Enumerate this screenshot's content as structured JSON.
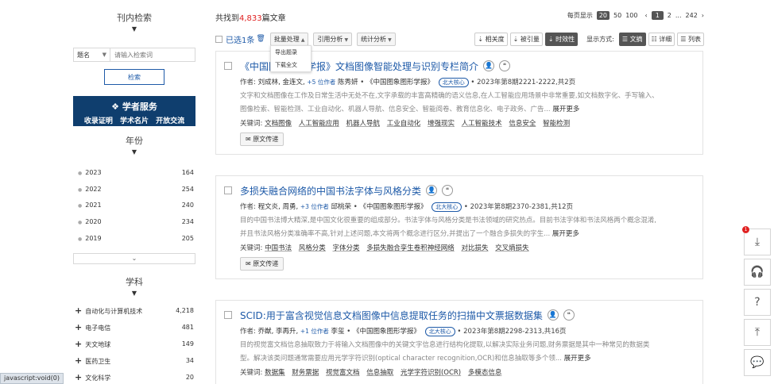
{
  "sidebar": {
    "title": "刊内检索",
    "field_label": "题名",
    "search_placeholder": "请输入检索词",
    "search_button": "检索",
    "promo_top": "学者服务",
    "promo_bottom": "收录证明 学术名片 开放交流",
    "year_title": "年份",
    "years": [
      {
        "label": "2023",
        "count": "164"
      },
      {
        "label": "2022",
        "count": "254"
      },
      {
        "label": "2021",
        "count": "240"
      },
      {
        "label": "2020",
        "count": "234"
      },
      {
        "label": "2019",
        "count": "205"
      }
    ],
    "subject_title": "学科",
    "subjects": [
      {
        "label": "自动化与计算机技术",
        "count": "4,218"
      },
      {
        "label": "电子电信",
        "count": "481"
      },
      {
        "label": "天文地球",
        "count": "149"
      },
      {
        "label": "医药卫生",
        "count": "34"
      },
      {
        "label": "文化科学",
        "count": "20"
      }
    ]
  },
  "results": {
    "found_prefix": "共找到",
    "found_count": "4,833",
    "found_suffix": "篇文章",
    "per_page_label": "每页显示",
    "per_page_options": [
      "20",
      "50",
      "100"
    ],
    "pages": [
      "1",
      "2",
      "...",
      "242"
    ],
    "prev": "‹",
    "next": "›"
  },
  "toolbar": {
    "selected": "已选1条",
    "batch": "批量处理",
    "citation": "引用分析",
    "stats": "统计分析",
    "sort_relevance": "相关度",
    "sort_cited": "被引量",
    "sort_time": "时效性",
    "display_label": "显示方式:",
    "view_abstract": "文摘",
    "view_detail": "详细",
    "view_list": "列表"
  },
  "batch_menu": {
    "export": "导出题录",
    "download": "下载全文"
  },
  "articles": [
    {
      "title": "《中国图象图形学报》文档图像智能处理与识别专栏简介",
      "author_label": "作者:",
      "authors": "刘成林, 金连文,",
      "more_authors": "+5 位作者",
      "last_author": "陈秀妍",
      "journal": "《中国图象图形学报》",
      "tag": "北大核心",
      "issue": "• 2023年第8期2221-2222,共2页",
      "abstract_1": "文字和文档图像在工作及日常生活中无处不在,文字承载的丰富高精确的语义信息,在人工智能应用场景中非常重要,如文档数字化、手写输入、",
      "abstract_2": "图像检索、智能检测、工业自动化、机器人导航、信息安全、智能阅卷、教育信息化、电子政务、广告...",
      "expand": "展开更多",
      "kw_label": "关键词:",
      "keywords": [
        "文档图像",
        "人工智能应用",
        "机器人导航",
        "工业自动化",
        "增强现实",
        "人工智能技术",
        "信息安全",
        "智能检测"
      ],
      "deliver": "原文传递"
    },
    {
      "title": "多损失融合网络的中国书法字体与风格分类",
      "author_label": "作者:",
      "authors": "程文炎, 周勇,",
      "more_authors": "+3 位作者",
      "last_author": "邱桃荣",
      "journal": "《中国图象图形学报》",
      "tag": "北大核心",
      "issue": "• 2023年第8期2370-2381,共12页",
      "abstract_1": "目的中国书法博大精深,是中国文化很重要的组成部分。书法字体与风格分类是书法领域的研究热点。目前书法字体和书法风格两个概念混淆,",
      "abstract_2": "并且书法风格分类准确率不高,针对上述问题,本文将两个概念进行区分,并提出了一个融合多损失的字生...",
      "expand": "展开更多",
      "kw_label": "关键词:",
      "keywords": [
        "中国书法",
        "风格分类",
        "字体分类",
        "多损失融合孪生卷积神经网络",
        "对比损失",
        "交叉熵损失"
      ],
      "deliver": "原文传递"
    },
    {
      "title": "SCID:用于富含视觉信息文档图像中信息提取任务的扫描中文票据数据集",
      "author_label": "作者:",
      "authors": "乔猷, 李再升,",
      "more_authors": "+1 位作者",
      "last_author": "李玺",
      "journal": "《中国图象图形学报》",
      "tag": "北大核心",
      "issue": "• 2023年第8期2298-2313,共16页",
      "abstract_1": "目的视觉富文档信息抽取致力于将输入文档图像中的关键文字信息进行结构化提取,以解决实际业务问题,财务票据是其中一种常见的数据类",
      "abstract_2": "型。解决该类问题通常需要应用光学字符识别(optical character recognition,OCR)和信息抽取等多个领...",
      "expand": "展开更多",
      "kw_label": "关键词:",
      "keywords": [
        "数据集",
        "财务票据",
        "视觉富文档",
        "信息抽取",
        "光学字符识别(OCR)",
        "多模态信息"
      ],
      "deliver": "原文传递"
    }
  ],
  "float_tools": {
    "badge": "1"
  },
  "status_bar": "javascript:void(0)"
}
